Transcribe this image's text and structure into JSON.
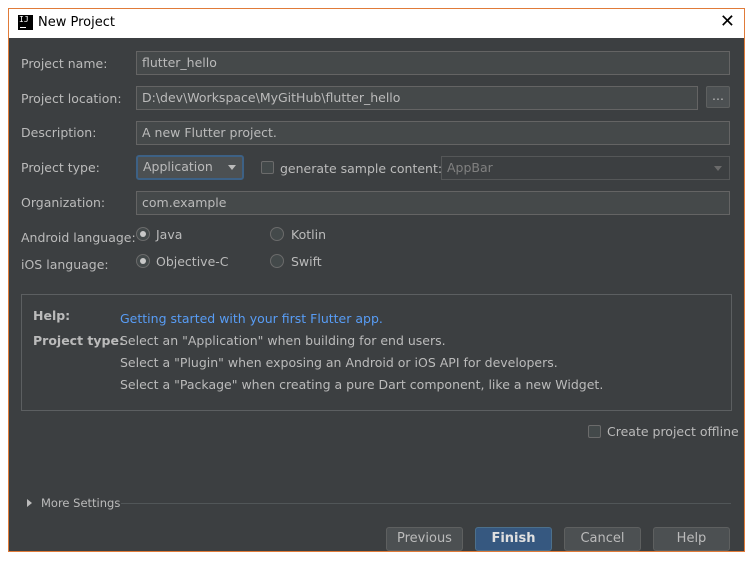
{
  "window": {
    "title": "New Project",
    "icon_text": "IJ"
  },
  "form": {
    "project_name": {
      "label": "Project name:",
      "value": "flutter_hello"
    },
    "project_location": {
      "label": "Project location:",
      "value": "D:\\dev\\Workspace\\MyGitHub\\flutter_hello",
      "browse_label": "..."
    },
    "description": {
      "label": "Description:",
      "value": "A new Flutter project."
    },
    "project_type": {
      "label": "Project type:",
      "value": "Application"
    },
    "generate_sample": {
      "label": "generate sample content:",
      "checked": false,
      "combo_value": "AppBar"
    },
    "organization": {
      "label": "Organization:",
      "value": "com.example"
    },
    "android_language": {
      "label": "Android language:",
      "options": [
        "Java",
        "Kotlin"
      ],
      "selected": "Java"
    },
    "ios_language": {
      "label": "iOS language:",
      "options": [
        "Objective-C",
        "Swift"
      ],
      "selected": "Objective-C"
    }
  },
  "help": {
    "help_key": "Help:",
    "help_link": "Getting started with your first Flutter app.",
    "type_key": "Project type:",
    "lines": [
      "Select an \"Application\" when building for end users.",
      "Select a \"Plugin\" when exposing an Android or iOS API for developers.",
      "Select a \"Package\" when creating a pure Dart component, like a new Widget."
    ]
  },
  "offline": {
    "label": "Create project offline",
    "checked": false
  },
  "more_settings": {
    "label": "More Settings"
  },
  "buttons": {
    "previous": "Previous",
    "finish": "Finish",
    "cancel": "Cancel",
    "help": "Help"
  },
  "colors": {
    "background": "#3c3f41",
    "link": "#589df6",
    "primary_button": "#365880",
    "window_border": "#e07b39"
  }
}
